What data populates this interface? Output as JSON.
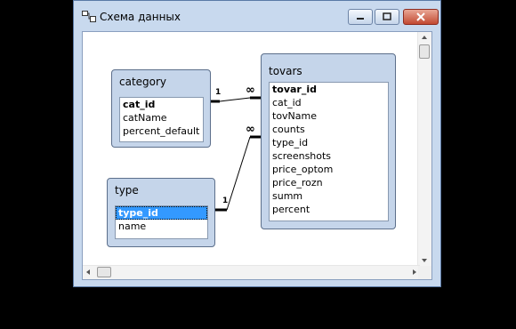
{
  "window": {
    "title": "Схема данных"
  },
  "tables": [
    {
      "name": "category",
      "fields": [
        {
          "name": "cat_id",
          "key": true
        },
        {
          "name": "catName"
        },
        {
          "name": "percent_default"
        }
      ]
    },
    {
      "name": "type",
      "fields": [
        {
          "name": "type_id",
          "key": true,
          "selected": true
        },
        {
          "name": "name"
        }
      ]
    },
    {
      "name": "tovars",
      "fields": [
        {
          "name": "tovar_id",
          "key": true
        },
        {
          "name": "cat_id"
        },
        {
          "name": "tovName"
        },
        {
          "name": "counts"
        },
        {
          "name": "type_id"
        },
        {
          "name": "screenshots"
        },
        {
          "name": "price_optom"
        },
        {
          "name": "price_rozn"
        },
        {
          "name": "summ"
        },
        {
          "name": "percent"
        }
      ]
    }
  ],
  "relationships": [
    {
      "from": "category.cat_id",
      "to": "tovars.cat_id",
      "one": "1",
      "many": "∞"
    },
    {
      "from": "type.type_id",
      "to": "tovars.type_id",
      "one": "1",
      "many": "∞"
    }
  ]
}
